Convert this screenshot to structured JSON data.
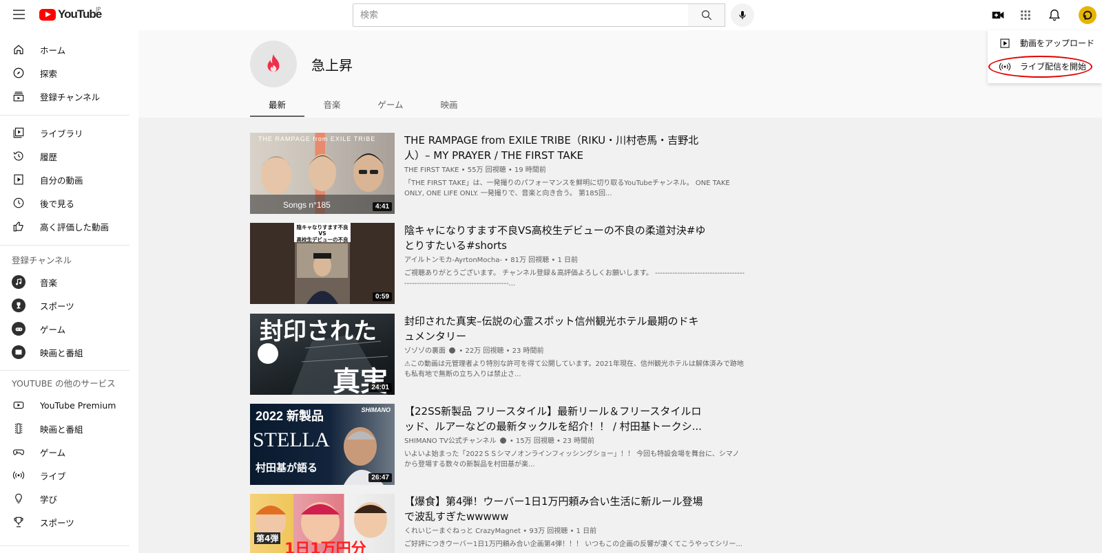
{
  "header": {
    "logo_text": "YouTube",
    "region": "JP",
    "search_placeholder": "検索"
  },
  "sidebar": {
    "main": [
      {
        "label": "ホーム",
        "icon": "home-icon"
      },
      {
        "label": "探索",
        "icon": "compass-icon"
      },
      {
        "label": "登録チャンネル",
        "icon": "subscriptions-icon"
      }
    ],
    "library": [
      {
        "label": "ライブラリ",
        "icon": "library-icon"
      },
      {
        "label": "履歴",
        "icon": "history-icon"
      },
      {
        "label": "自分の動画",
        "icon": "your-videos-icon"
      },
      {
        "label": "後で見る",
        "icon": "watch-later-icon"
      },
      {
        "label": "高く評価した動画",
        "icon": "thumbs-up-icon"
      }
    ],
    "subscriptions_title": "登録チャンネル",
    "subscriptions": [
      {
        "label": "音楽",
        "icon": "music-icon"
      },
      {
        "label": "スポーツ",
        "icon": "trophy-icon"
      },
      {
        "label": "ゲーム",
        "icon": "gaming-icon"
      },
      {
        "label": "映画と番組",
        "icon": "movies-icon"
      }
    ],
    "more_title": "YOUTUBE の他のサービス",
    "more": [
      {
        "label": "YouTube Premium",
        "icon": "youtube-premium-icon"
      },
      {
        "label": "映画と番組",
        "icon": "film-icon"
      },
      {
        "label": "ゲーム",
        "icon": "gamepad-icon"
      },
      {
        "label": "ライブ",
        "icon": "live-icon"
      },
      {
        "label": "学び",
        "icon": "lightbulb-icon"
      },
      {
        "label": "スポーツ",
        "icon": "trophy-outline-icon"
      }
    ]
  },
  "channel": {
    "title": "急上昇",
    "tabs": [
      "最新",
      "音楽",
      "ゲーム",
      "映画"
    ],
    "active_tab": "最新"
  },
  "videos": [
    {
      "title": "THE RAMPAGE from EXILE TRIBE（RIKU・川村壱馬・吉野北人）– MY PRAYER / THE FIRST TAKE",
      "channel": "THE FIRST TAKE",
      "verified": false,
      "views": "55万 回視聴",
      "age": "19 時間前",
      "description": "「THE FIRST TAKE」は、一発撮りのパフォーマンスを鮮明に切り取るYouTubeチャンネル。 ONE TAKE ONLY, ONE LIFE ONLY. 一発撮りで、音楽と向き合う。 第185回...",
      "duration": "4:41",
      "thumb_text_top": "THE RAMPAGE from EXILE TRIBE",
      "thumb_text_bottom": "Songs n°185"
    },
    {
      "title": "陰キャになりすます不良VS高校生デビューの不良の柔道対決#ゆとりすたいる#shorts",
      "channel": "アイルトンモカ-AyrtonMocha-",
      "verified": false,
      "views": "81万 回視聴",
      "age": "1 日前",
      "description": "ご視聴ありがとうございます。 チャンネル登録＆高評価よろしくお願いします。 ------------------------------------------------------------------------------...",
      "duration": "0:59",
      "thumb_text_top": "陰キャなりすます不良",
      "thumb_text_vs": "VS",
      "thumb_text_bottom": "高校生デビューの不良"
    },
    {
      "title": "封印された真実–伝説の心霊スポット信州観光ホテル最期のドキュメンタリー",
      "channel": "ゾゾゾの裏面",
      "verified": true,
      "views": "22万 回視聴",
      "age": "23 時間前",
      "description": "⚠この動画は元管理者より特別な許可を得て公開しています。2021年現在、信州観光ホテルは解体済みで跡地も私有地で無断の立ち入りは禁止さ...",
      "duration": "24:01",
      "thumb_text_top": "封印された",
      "thumb_text_bottom": "真実"
    },
    {
      "title": "【22SS新製品 フリースタイル】最新リール＆フリースタイルロッド、ルアーなどの最新タックルを紹介！！ / 村田基トークシ...",
      "channel": "SHIMANO TV公式チャンネル",
      "verified": true,
      "views": "15万 回視聴",
      "age": "23 時間前",
      "description": "いよいよ始まった「2022ＳＳシマノオンラインフィッシングショー」！！ 今回も特設会場を舞台に、シマノから登場する数々の新製品を村田基が楽...",
      "duration": "26:47",
      "thumb_text_top": "2022 新製品",
      "thumb_text_mid": "STELLA",
      "thumb_text_bottom": "村田基が語る",
      "thumb_brand": "SHIMANO"
    },
    {
      "title": "【爆食】第4弾！ウーバー1日1万円頼み合い生活に新ルール登場で波乱すぎたwwwww",
      "channel": "くれいじーまぐねっと CrazyMagnet",
      "verified": false,
      "views": "93万 回視聴",
      "age": "1 日前",
      "description": "ご好評につきウーバー1日1万円頼み合い企画第4弾！！！ いつもこの企画の反響が凄くてこうやってシリー...",
      "duration": "",
      "thumb_text_top": "第4弾",
      "thumb_text_bottom": "1日1万円分"
    }
  ],
  "dropdown": {
    "items": [
      {
        "label": "動画をアップロード",
        "icon": "upload-icon"
      },
      {
        "label": "ライブ配信を開始",
        "icon": "go-live-icon"
      }
    ]
  },
  "colors": {
    "brand_red": "#ff0000",
    "highlight_oval": "#e00000",
    "trending_icon": "#ef2f4a"
  }
}
